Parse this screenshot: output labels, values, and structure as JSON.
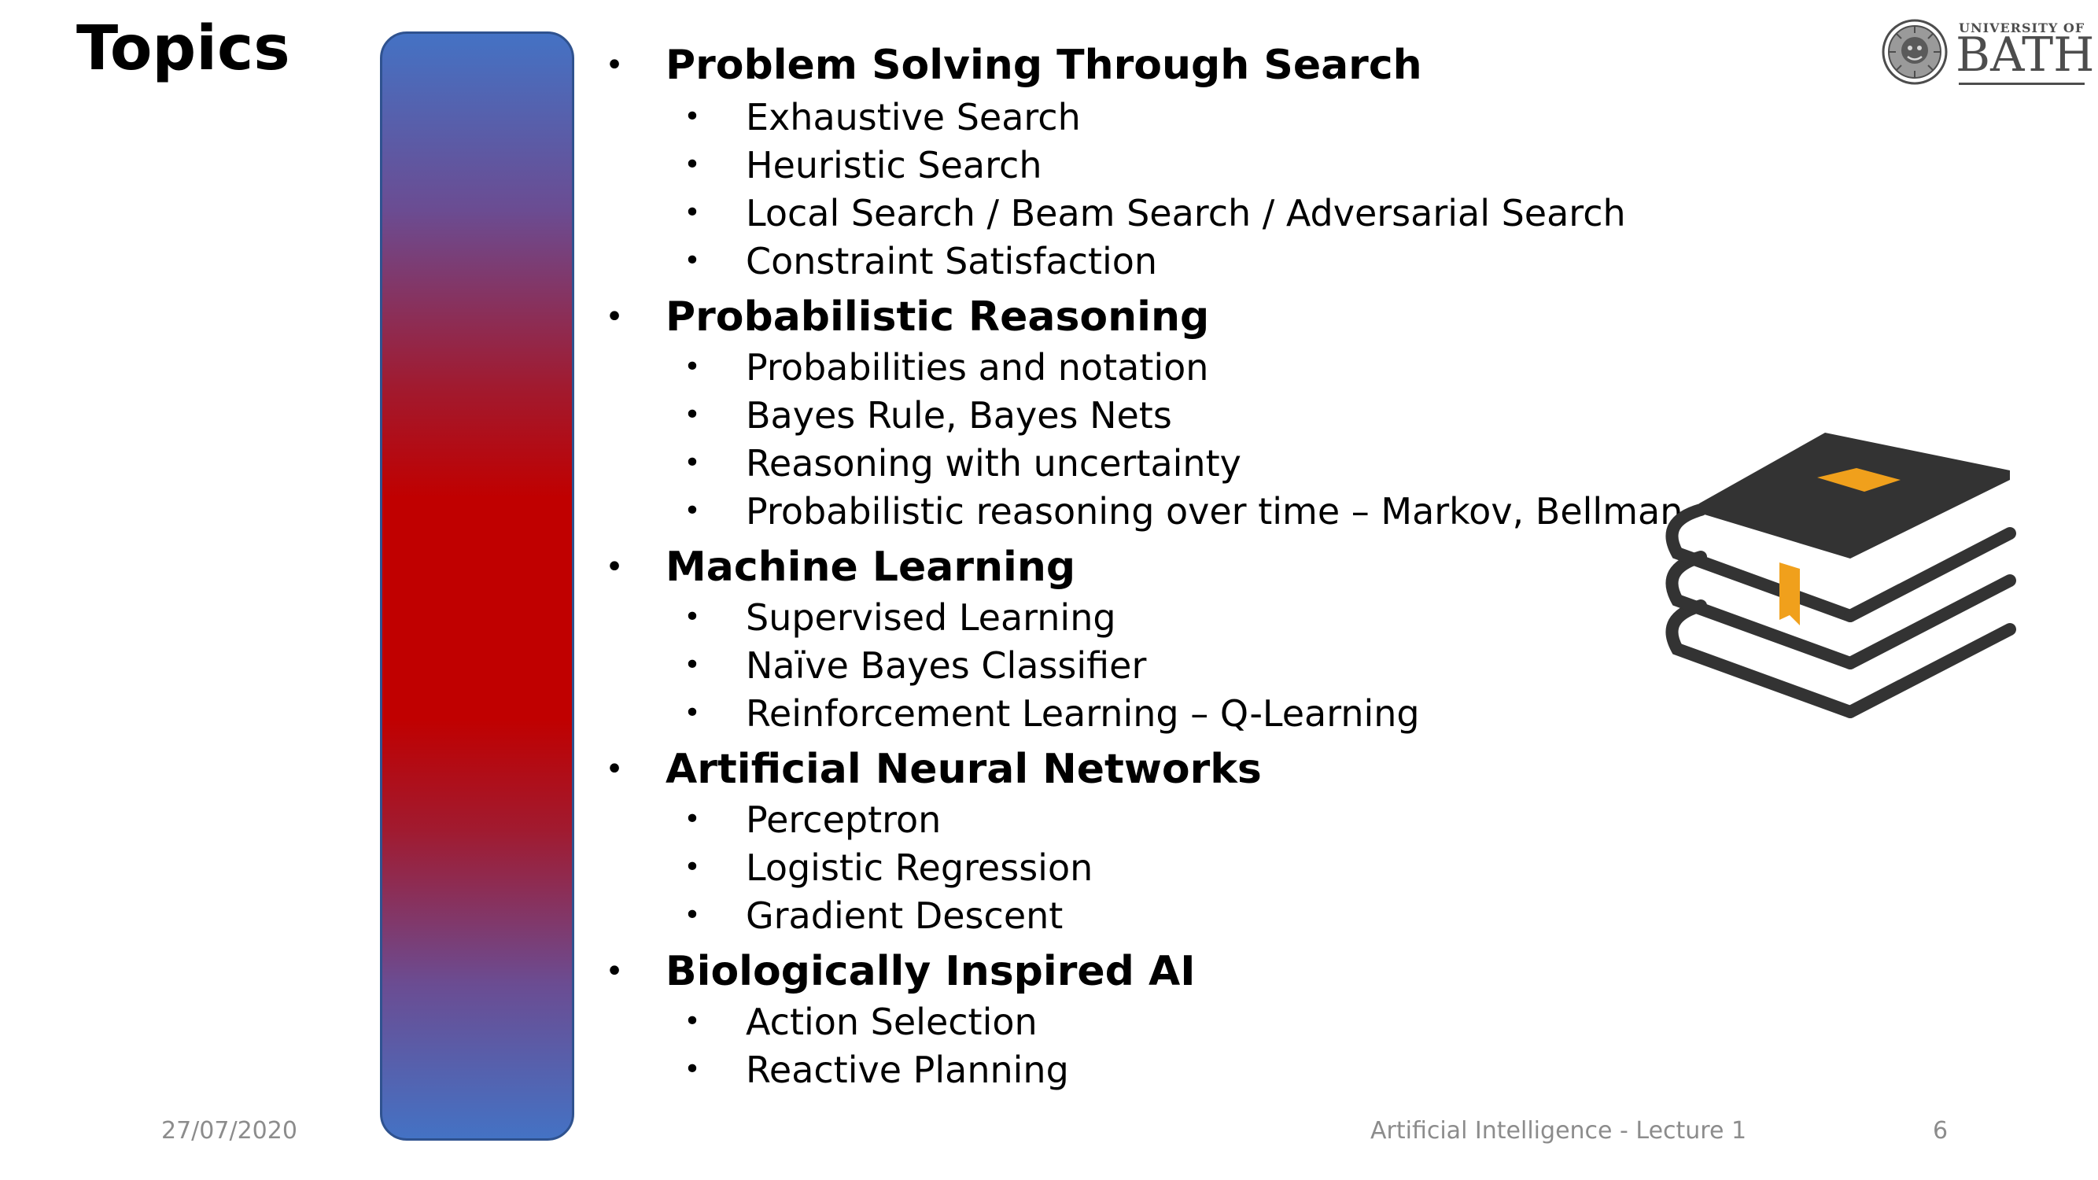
{
  "slide": {
    "title": "Topics",
    "topics": [
      {
        "title": "Problem Solving Through Search",
        "items": [
          "Exhaustive Search",
          "Heuristic Search",
          "Local Search / Beam Search / Adversarial Search",
          "Constraint Satisfaction"
        ]
      },
      {
        "title": "Probabilistic Reasoning",
        "items": [
          "Probabilities and notation",
          "Bayes Rule, Bayes Nets",
          "Reasoning with uncertainty",
          "Probabilistic reasoning over time – Markov, Bellman"
        ]
      },
      {
        "title": "Machine Learning",
        "items": [
          "Supervised Learning",
          "Naïve Bayes Classifier",
          "Reinforcement Learning – Q-Learning"
        ]
      },
      {
        "title": "Artificial Neural Networks",
        "items": [
          "Perceptron",
          "Logistic Regression",
          "Gradient Descent"
        ]
      },
      {
        "title": "Biologically Inspired AI",
        "items": [
          "Action Selection",
          "Reactive Planning"
        ]
      }
    ]
  },
  "logo": {
    "line1": "UNIVERSITY OF",
    "line2": "BATH"
  },
  "footer": {
    "date": "27/07/2020",
    "course": "Artificial Intelligence - Lecture 1",
    "page": "6"
  },
  "icons": {
    "books": "stacked-books-icon",
    "crest": "university-crest-icon"
  },
  "colors": {
    "bar_top": "#4472c4",
    "bar_middle": "#c00000",
    "book_dark": "#333333",
    "book_accent": "#f0a01c",
    "footer_text": "#8c8c8c"
  }
}
